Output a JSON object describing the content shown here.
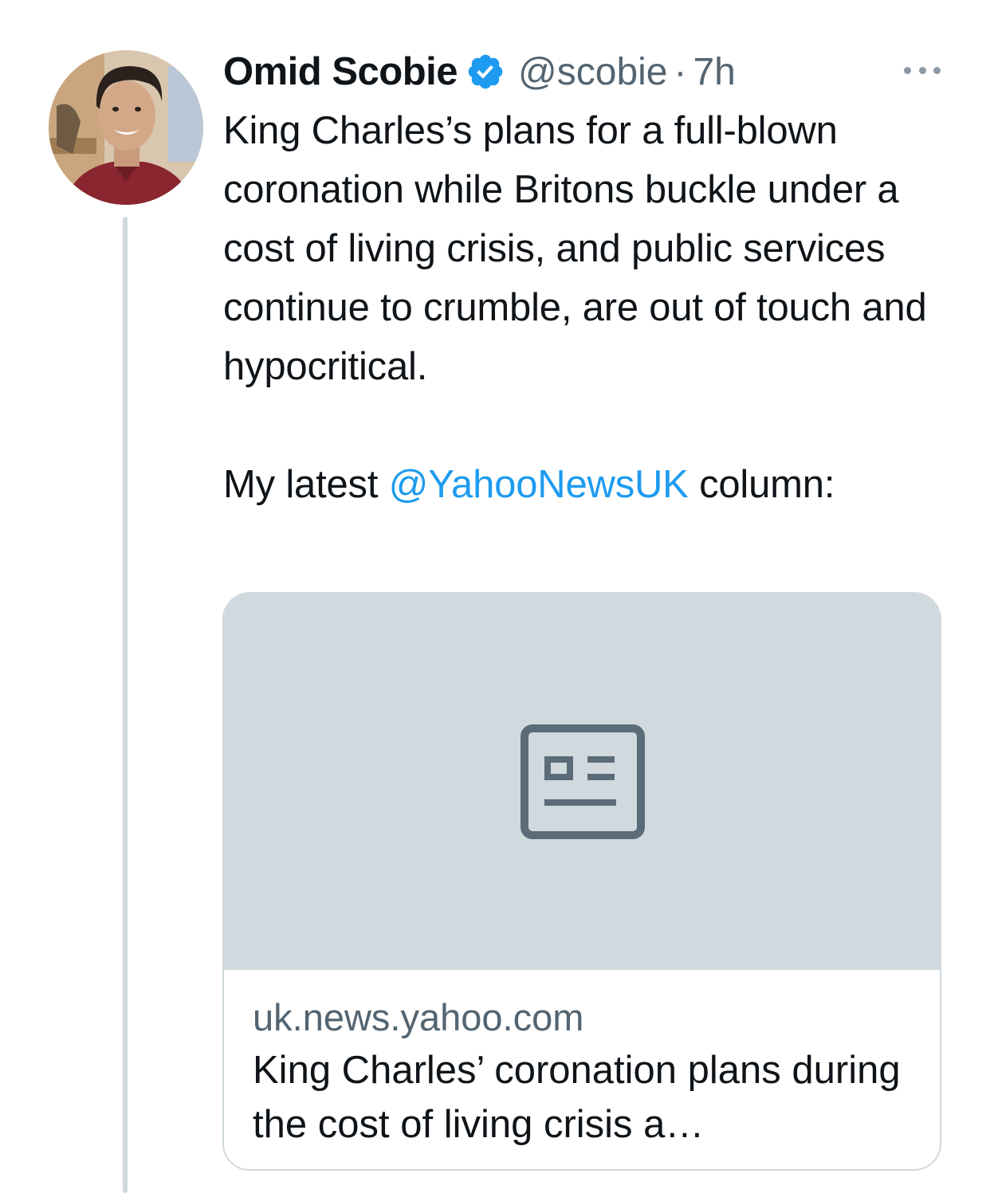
{
  "tweet": {
    "author_name": "Omid Scobie",
    "handle": "@scobie",
    "separator": "·",
    "time": "7h",
    "text_paragraph_1": "King Charles’s plans for a full-blown coronation while Britons buckle under a cost of living crisis, and public services continue to crumble, are out of touch and hypocritical.",
    "text_paragraph_2_prefix": "My latest ",
    "text_paragraph_2_mention": "@YahooNewsUK",
    "text_paragraph_2_suffix": " column:",
    "verified_icon": "verified-badge-icon",
    "more_icon": "more-options-icon"
  },
  "link_card": {
    "domain": "uk.news.yahoo.com",
    "title": "King Charles’ coronation plans during the cost of living crisis a…",
    "placeholder_icon": "news-article-icon"
  },
  "colors": {
    "text": "#0f1419",
    "secondary_text": "#536471",
    "link": "#1d9bf0",
    "verified": "#1d9bf0",
    "card_media_bg": "#cfd9de",
    "thread_line": "#cfd9de"
  }
}
